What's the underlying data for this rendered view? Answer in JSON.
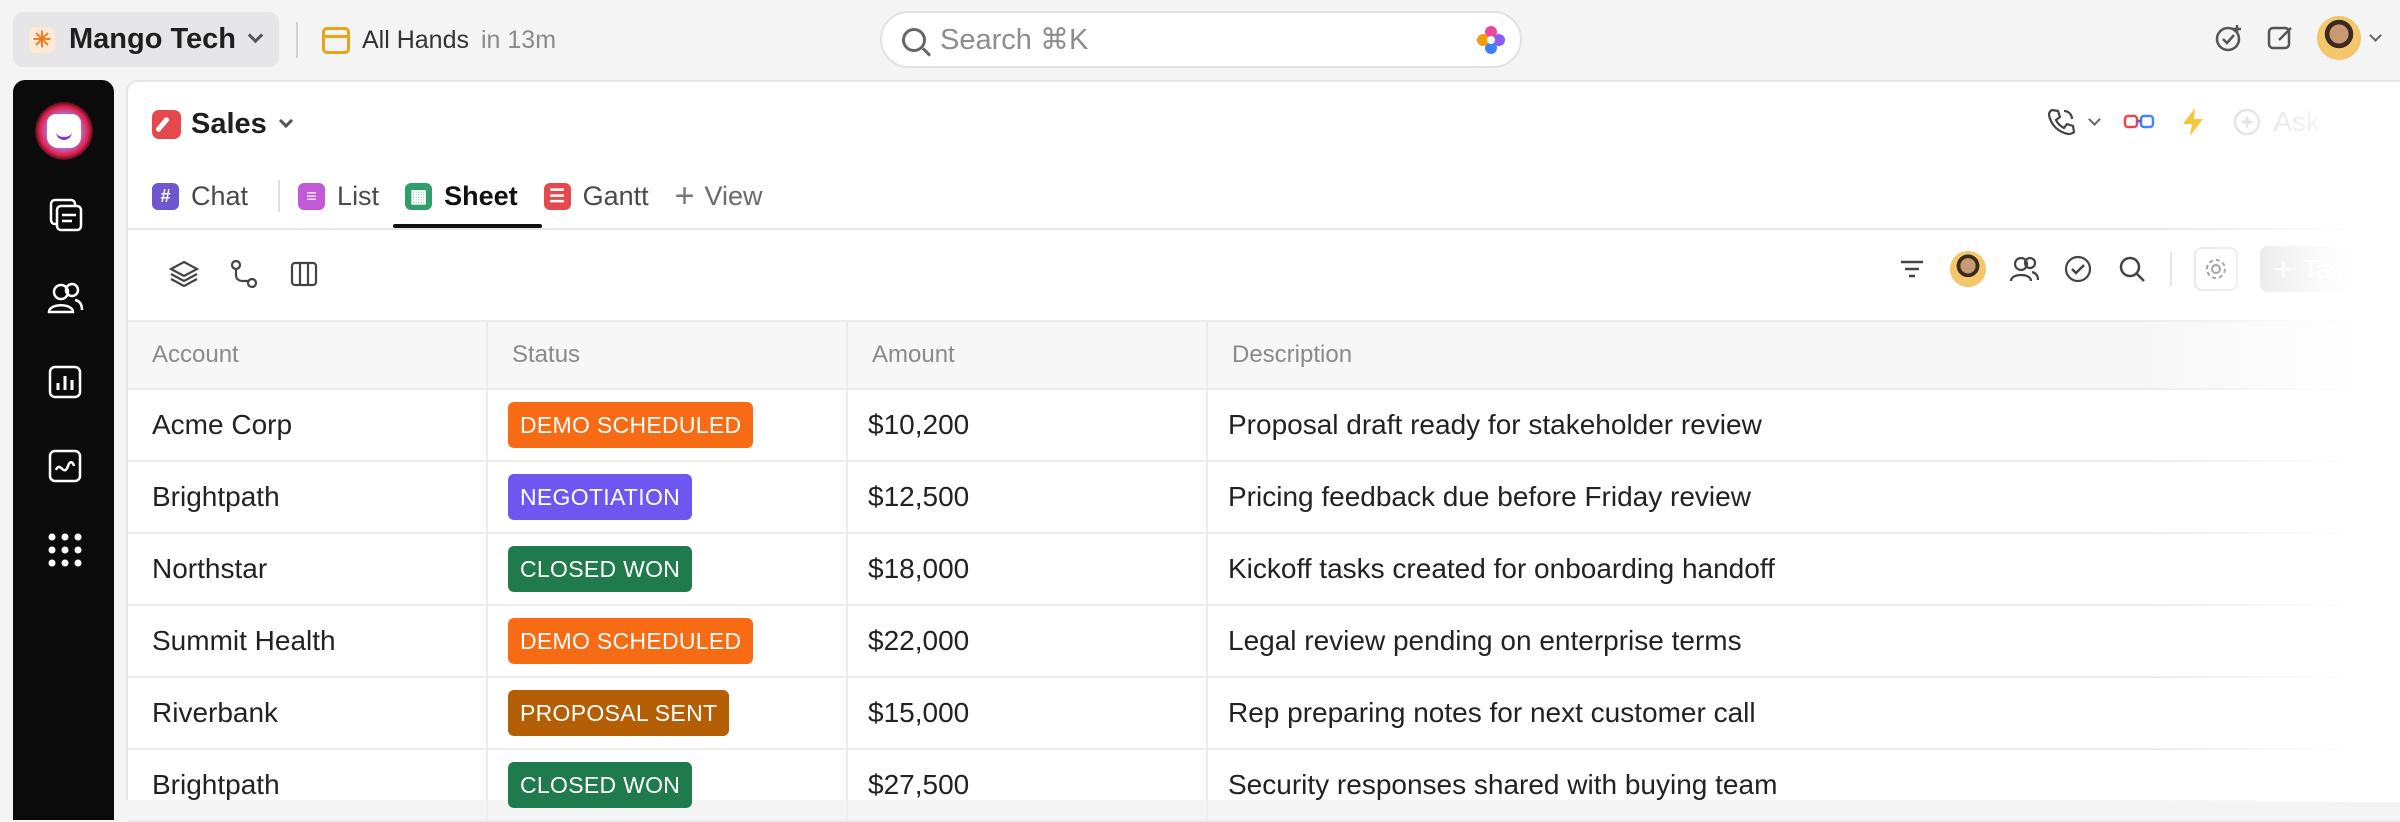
{
  "workspace": {
    "name": "Mango Tech",
    "logo_glyph": "✳"
  },
  "event": {
    "title": "All Hands",
    "time": "in 13m"
  },
  "search": {
    "placeholder": "Search ⌘K"
  },
  "list": {
    "title": "Sales",
    "ask_label": "Ask"
  },
  "tabs": [
    {
      "label": "Chat",
      "icon": "hash-icon",
      "color": "#6e56cf",
      "glyph": "#"
    },
    {
      "label": "List",
      "icon": "list-icon",
      "color": "#c05ad6",
      "glyph": "≡"
    },
    {
      "label": "Sheet",
      "icon": "sheet-icon",
      "color": "#2f9e6b",
      "glyph": "▦"
    },
    {
      "label": "Gantt",
      "icon": "gantt-icon",
      "color": "#e5484d",
      "glyph": "☰"
    }
  ],
  "add_view_label": "View",
  "task_button_label": "Task",
  "table": {
    "columns": [
      "Account",
      "Status",
      "Amount",
      "Description"
    ],
    "rows": [
      {
        "account": "Acme Corp",
        "status": "DEMO SCHEDULED",
        "status_color": "#f76b15",
        "amount": "$10,200",
        "description": "Proposal draft ready for stakeholder review"
      },
      {
        "account": "Brightpath",
        "status": "NEGOTIATION",
        "status_color": "#6e56f0",
        "amount": "$12,500",
        "description": "Pricing feedback due before Friday review"
      },
      {
        "account": "Northstar",
        "status": "CLOSED WON",
        "status_color": "#1f7a4c",
        "amount": "$18,000",
        "description": "Kickoff tasks created for onboarding handoff"
      },
      {
        "account": "Summit Health",
        "status": "DEMO SCHEDULED",
        "status_color": "#f76b15",
        "amount": "$22,000",
        "description": "Legal review pending on enterprise terms"
      },
      {
        "account": "Riverbank",
        "status": "PROPOSAL SENT",
        "status_color": "#b45f06",
        "amount": "$15,000",
        "description": "Rep preparing notes for next customer call"
      },
      {
        "account": "Brightpath",
        "status": "CLOSED WON",
        "status_color": "#1f7a4c",
        "amount": "$27,500",
        "description": "Security responses shared with buying team"
      }
    ]
  }
}
